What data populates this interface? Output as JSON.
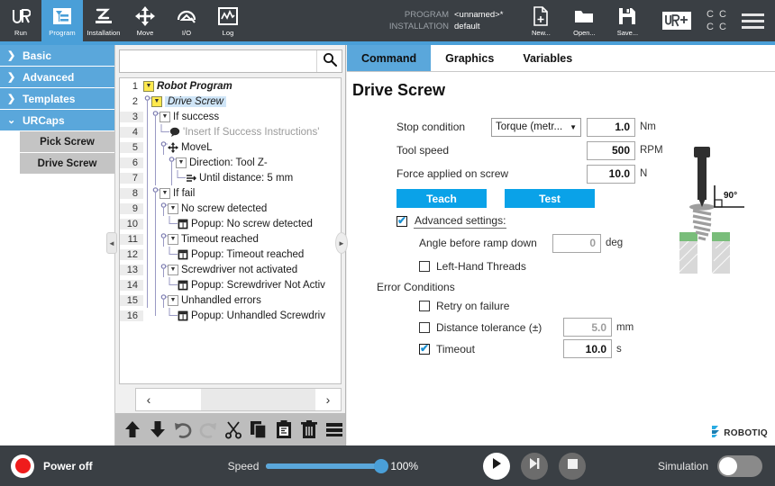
{
  "header": {
    "tabs": [
      {
        "label": "Run",
        "icon": "ur-logo-icon",
        "active": false
      },
      {
        "label": "Program",
        "icon": "program-icon",
        "active": true
      },
      {
        "label": "Installation",
        "icon": "robot-arm-icon",
        "active": false
      },
      {
        "label": "Move",
        "icon": "move-arrows-icon",
        "active": false
      },
      {
        "label": "I/O",
        "icon": "io-icon",
        "active": false
      },
      {
        "label": "Log",
        "icon": "log-graph-icon",
        "active": false
      }
    ],
    "program_key": "PROGRAM",
    "program_value": "<unnamed>*",
    "installation_key": "INSTALLATION",
    "installation_value": "default",
    "files": [
      {
        "label": "New...",
        "icon": "new-file-icon"
      },
      {
        "label": "Open...",
        "icon": "open-folder-icon"
      },
      {
        "label": "Save...",
        "icon": "save-disk-icon"
      }
    ],
    "urplus_label": "UR+",
    "grid_glyphs": [
      "C",
      "C",
      "C",
      "C"
    ],
    "menu_icon": "hamburger-menu-icon",
    "accent_color": "#4a9fd8"
  },
  "sidebar": {
    "categories": [
      {
        "label": "Basic",
        "expanded": false
      },
      {
        "label": "Advanced",
        "expanded": false
      },
      {
        "label": "Templates",
        "expanded": false
      },
      {
        "label": "URCaps",
        "expanded": true
      }
    ],
    "urcaps_items": [
      {
        "label": "Pick Screw"
      },
      {
        "label": "Drive Screw"
      }
    ]
  },
  "tree": {
    "search_value": "",
    "search_placeholder": "",
    "search_icon": "search-icon",
    "rows": [
      {
        "num": "1",
        "indent": 0,
        "marker": "yellow",
        "pin": false,
        "elbow": false,
        "text": "Robot Program",
        "style": "bold-italic",
        "selected": false
      },
      {
        "num": "2",
        "indent": 0,
        "marker": "yellow",
        "pin": true,
        "elbow": false,
        "text": "Drive Screw",
        "style": "italic",
        "selected": true
      },
      {
        "num": "3",
        "indent": 1,
        "marker": "white",
        "pin": true,
        "elbow": false,
        "text": "If success",
        "style": "normal",
        "selected": false
      },
      {
        "num": "4",
        "indent": 2,
        "marker": "comment",
        "pin": false,
        "elbow": true,
        "text": "'Insert If Success Instructions'",
        "style": "grey",
        "selected": false
      },
      {
        "num": "5",
        "indent": 2,
        "marker": "move",
        "pin": true,
        "elbow": false,
        "text": "MoveL",
        "style": "normal",
        "selected": false
      },
      {
        "num": "6",
        "indent": 3,
        "marker": "white",
        "pin": true,
        "elbow": false,
        "text": "Direction: Tool Z-",
        "style": "normal",
        "selected": false
      },
      {
        "num": "7",
        "indent": 4,
        "marker": "until",
        "pin": false,
        "elbow": true,
        "text": "Until distance: 5 mm",
        "style": "normal",
        "selected": false
      },
      {
        "num": "8",
        "indent": 1,
        "marker": "white",
        "pin": true,
        "elbow": false,
        "text": "If fail",
        "style": "normal",
        "selected": false
      },
      {
        "num": "9",
        "indent": 2,
        "marker": "white",
        "pin": true,
        "elbow": false,
        "text": "No screw detected",
        "style": "normal",
        "selected": false
      },
      {
        "num": "10",
        "indent": 3,
        "marker": "popup",
        "pin": false,
        "elbow": true,
        "text": "Popup: No screw detected",
        "style": "normal",
        "selected": false
      },
      {
        "num": "11",
        "indent": 2,
        "marker": "white",
        "pin": true,
        "elbow": false,
        "text": "Timeout reached",
        "style": "normal",
        "selected": false
      },
      {
        "num": "12",
        "indent": 3,
        "marker": "popup",
        "pin": false,
        "elbow": true,
        "text": "Popup: Timeout reached",
        "style": "normal",
        "selected": false
      },
      {
        "num": "13",
        "indent": 2,
        "marker": "white",
        "pin": true,
        "elbow": false,
        "text": "Screwdriver not activated",
        "style": "normal",
        "selected": false
      },
      {
        "num": "14",
        "indent": 3,
        "marker": "popup",
        "pin": false,
        "elbow": true,
        "text": "Popup: Screwdriver Not Activ",
        "style": "normal",
        "selected": false
      },
      {
        "num": "15",
        "indent": 2,
        "marker": "white",
        "pin": true,
        "elbow": false,
        "text": "Unhandled errors",
        "style": "normal",
        "selected": false
      },
      {
        "num": "16",
        "indent": 3,
        "marker": "popup",
        "pin": false,
        "elbow": true,
        "text": "Popup: Unhandled Screwdriv",
        "style": "normal",
        "selected": false
      }
    ],
    "pager": {
      "prev": "‹",
      "next": "›"
    },
    "tools": [
      {
        "name": "move-up-icon"
      },
      {
        "name": "move-down-icon"
      },
      {
        "name": "undo-icon"
      },
      {
        "name": "redo-icon"
      },
      {
        "name": "cut-icon"
      },
      {
        "name": "copy-icon"
      },
      {
        "name": "paste-icon"
      },
      {
        "name": "delete-trash-icon"
      },
      {
        "name": "suppress-icon"
      }
    ],
    "collapse_left": "◄",
    "collapse_right": "►"
  },
  "main": {
    "tabs": [
      {
        "label": "Command",
        "active": true
      },
      {
        "label": "Graphics",
        "active": false
      },
      {
        "label": "Variables",
        "active": false
      }
    ],
    "title": "Drive Screw",
    "fields": {
      "stop_condition_label": "Stop condition",
      "stop_condition_value": "Torque (metr...",
      "stop_condition_number": "1.0",
      "stop_condition_unit": "Nm",
      "tool_speed_label": "Tool speed",
      "tool_speed_value": "500",
      "tool_speed_unit": "RPM",
      "force_label": "Force applied on screw",
      "force_value": "10.0",
      "force_unit": "N"
    },
    "buttons": {
      "teach": "Teach",
      "test": "Test"
    },
    "advanced": {
      "label": "Advanced settings:",
      "checked": true,
      "angle_label": "Angle before ramp down",
      "angle_value": "0",
      "angle_unit": "deg",
      "left_hand_label": "Left-Hand Threads",
      "left_hand_checked": false,
      "error_conditions_label": "Error Conditions",
      "retry_label": "Retry on failure",
      "retry_checked": false,
      "distance_label": "Distance tolerance (±)",
      "distance_value": "5.0",
      "distance_unit": "mm",
      "distance_checked": false,
      "timeout_label": "Timeout",
      "timeout_value": "10.0",
      "timeout_unit": "s",
      "timeout_checked": true
    },
    "diagram": {
      "name": "screw-driving-diagram",
      "angle_label": "90°"
    },
    "brand": "ROBOTIQ"
  },
  "footer": {
    "power_label": "Power off",
    "power_state_color": "#ef1c1c",
    "speed_label": "Speed",
    "speed_value": "100%",
    "speed_percent": 100,
    "play_icon": "play-icon",
    "step_icon": "step-icon",
    "stop_icon": "stop-icon",
    "simulation_label": "Simulation",
    "simulation_on": false
  }
}
